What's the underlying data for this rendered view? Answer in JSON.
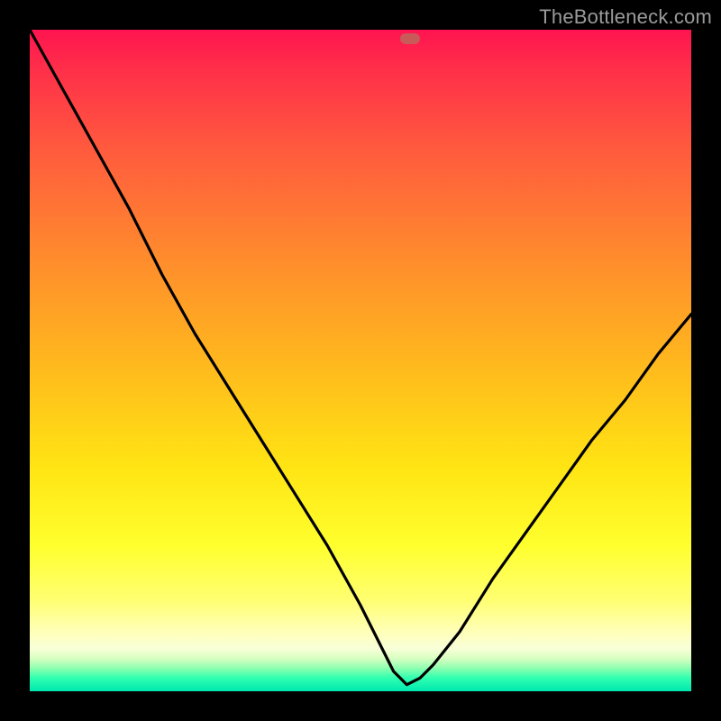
{
  "watermark": "TheBottleneck.com",
  "marker": {
    "x_pct": 57.5,
    "y_pct": 98.6
  },
  "colors": {
    "top": "#ff1450",
    "mid": "#ffe413",
    "bottom": "#00e8b0",
    "curve": "#000000",
    "marker": "#c85a5a",
    "frame": "#000000"
  },
  "chart_data": {
    "type": "line",
    "title": "",
    "xlabel": "",
    "ylabel": "",
    "xlim": [
      0,
      100
    ],
    "ylim": [
      0,
      100
    ],
    "grid": false,
    "legend": false,
    "note": "Axes are implicit 0-100 percentage scales (no ticks shown). y-values are approximate bottleneck percentage read from the curve. The minimum near x≈57 indicates the balanced configuration.",
    "series": [
      {
        "name": "bottleneck-curve",
        "x": [
          0,
          5,
          10,
          15,
          20,
          25,
          30,
          35,
          40,
          45,
          50,
          53,
          55,
          57,
          59,
          61,
          65,
          70,
          75,
          80,
          85,
          90,
          95,
          100
        ],
        "y": [
          100,
          91,
          82,
          73,
          63,
          54,
          46,
          38,
          30,
          22,
          13,
          7,
          3,
          1,
          2,
          4,
          9,
          17,
          24,
          31,
          38,
          44,
          51,
          57
        ]
      }
    ],
    "markers": [
      {
        "name": "optimal-point",
        "x": 57.5,
        "y": 1.4
      }
    ]
  }
}
